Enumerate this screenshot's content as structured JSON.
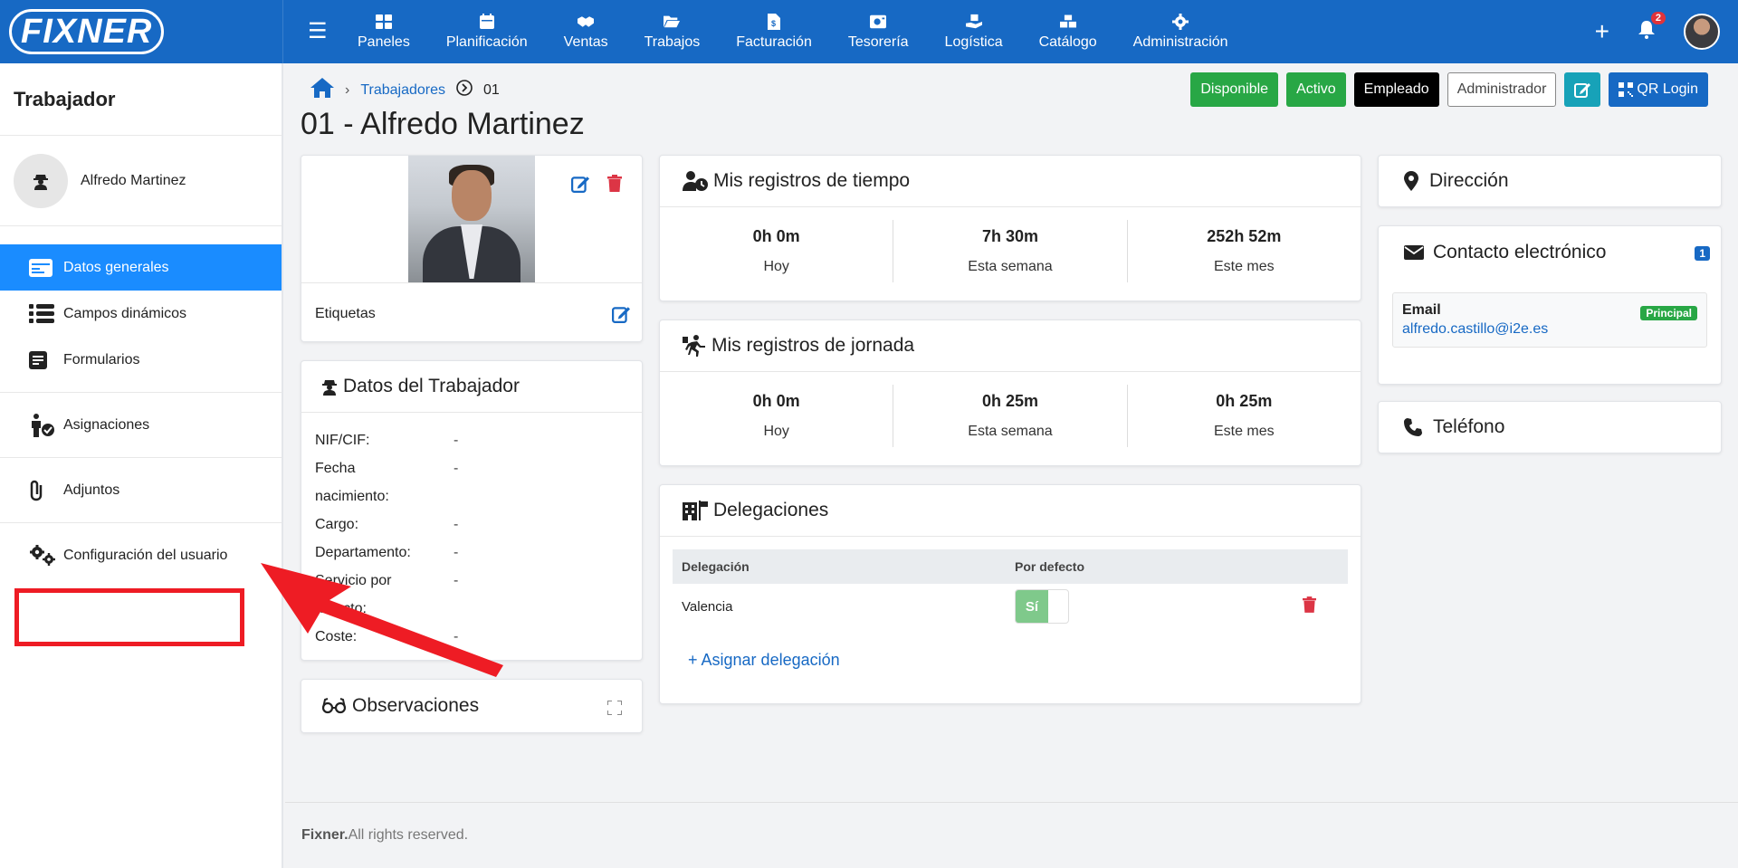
{
  "header": {
    "logo": "FIXNER",
    "nav": [
      {
        "label": "Paneles",
        "icon": "dashboard-icon"
      },
      {
        "label": "Planificación",
        "icon": "calendar-icon"
      },
      {
        "label": "Ventas",
        "icon": "handshake-icon"
      },
      {
        "label": "Trabajos",
        "icon": "folder-open-icon"
      },
      {
        "label": "Facturación",
        "icon": "invoice-icon"
      },
      {
        "label": "Tesorería",
        "icon": "cash-register-icon"
      },
      {
        "label": "Logística",
        "icon": "box-hand-icon"
      },
      {
        "label": "Catálogo",
        "icon": "boxes-icon"
      },
      {
        "label": "Administración",
        "icon": "gear-icon"
      }
    ],
    "notifications_count": "2"
  },
  "sidebar": {
    "title": "Trabajador",
    "user_name": "Alfredo Martinez",
    "items": [
      {
        "label": "Datos generales",
        "icon": "id-card-icon",
        "active": true
      },
      {
        "label": "Campos dinámicos",
        "icon": "list-icon"
      },
      {
        "label": "Formularios",
        "icon": "form-icon"
      },
      {
        "label": "Asignaciones",
        "icon": "person-check-icon"
      },
      {
        "label": "Adjuntos",
        "icon": "paperclip-icon"
      },
      {
        "label": "Configuración del usuario",
        "icon": "gears-icon"
      }
    ]
  },
  "breadcrumb": {
    "link": "Trabajadores",
    "current": "01"
  },
  "page_title": "01 - Alfredo Martinez",
  "actions": {
    "disponible": "Disponible",
    "activo": "Activo",
    "empleado": "Empleado",
    "administrador": "Administrador",
    "qr_login": "QR Login"
  },
  "photo_card": {
    "tags_label": "Etiquetas"
  },
  "worker_data": {
    "title": "Datos del Trabajador",
    "rows": [
      {
        "key": "NIF/CIF:",
        "value": "-"
      },
      {
        "key": "Fecha nacimiento:",
        "value": "-"
      },
      {
        "key": "Cargo:",
        "value": "-"
      },
      {
        "key": "Departamento:",
        "value": "-"
      },
      {
        "key": "Servicio por defecto:",
        "value": "-"
      },
      {
        "key": "Coste:",
        "value": "-"
      }
    ]
  },
  "observations": {
    "title": "Observaciones"
  },
  "time_records": {
    "title": "Mis registros de tiempo",
    "stats": [
      {
        "value": "0h 0m",
        "label": "Hoy"
      },
      {
        "value": "7h 30m",
        "label": "Esta semana"
      },
      {
        "value": "252h 52m",
        "label": "Este mes"
      }
    ]
  },
  "shift_records": {
    "title": "Mis registros de jornada",
    "stats": [
      {
        "value": "0h 0m",
        "label": "Hoy"
      },
      {
        "value": "0h 25m",
        "label": "Esta semana"
      },
      {
        "value": "0h 25m",
        "label": "Este mes"
      }
    ]
  },
  "delegations": {
    "title": "Delegaciones",
    "headers": [
      "Delegación",
      "Por defecto"
    ],
    "rows": [
      {
        "name": "Valencia",
        "default": "Sí"
      }
    ],
    "assign_label": "+ Asignar delegación"
  },
  "address": {
    "title": "Dirección"
  },
  "contact": {
    "title": "Contacto electrónico",
    "count": "1",
    "email_label": "Email",
    "email": "alfredo.castillo@i2e.es",
    "badge": "Principal"
  },
  "phone": {
    "title": "Teléfono"
  },
  "footer": {
    "brand": "Fixner.",
    "text": " All rights reserved."
  },
  "colors": {
    "primary": "#1769c4",
    "active": "#1a8cff",
    "success": "#28a745",
    "danger": "#dc3545",
    "highlight": "#ee1c24"
  }
}
